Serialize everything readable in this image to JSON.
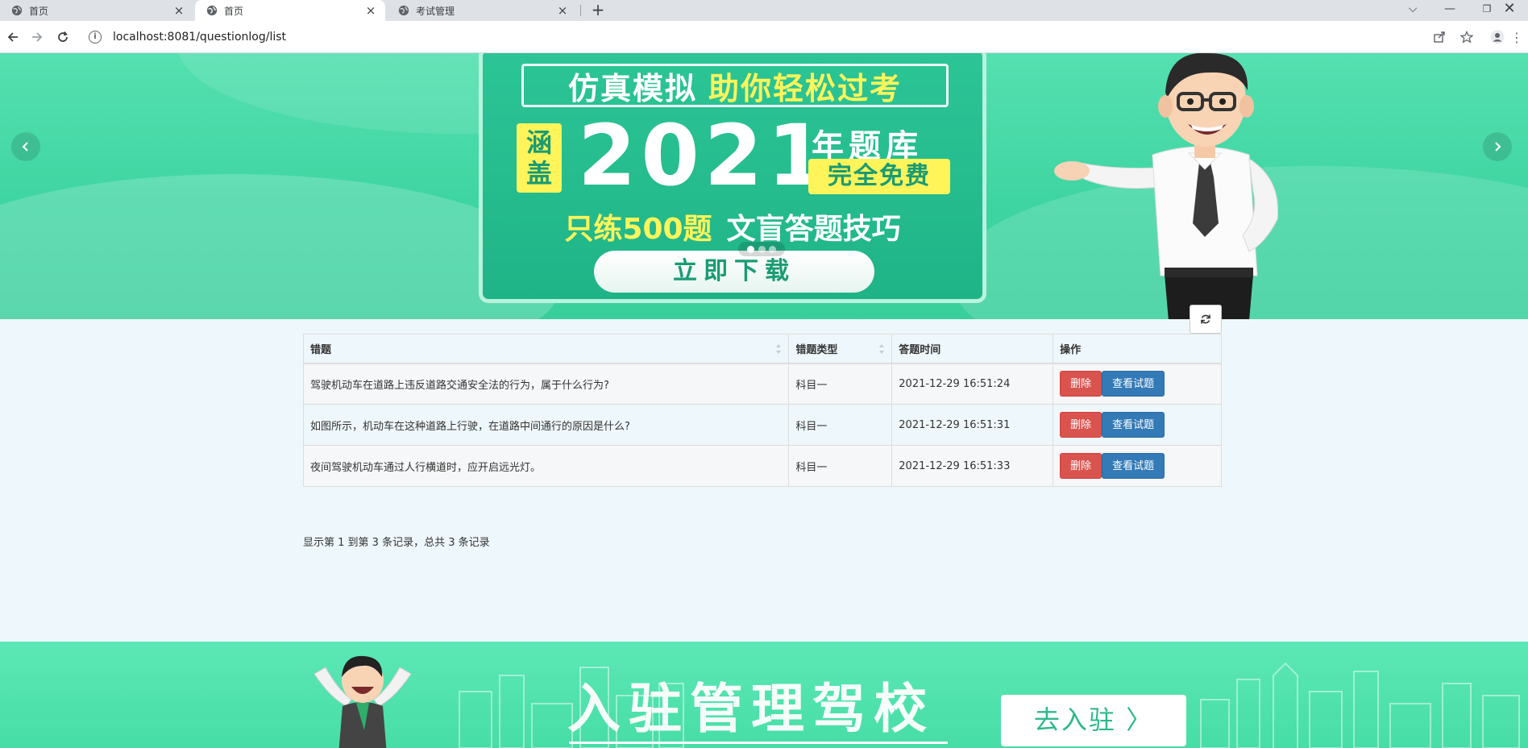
{
  "browser": {
    "tabs": [
      {
        "title": "首页",
        "active": false
      },
      {
        "title": "首页",
        "active": true
      },
      {
        "title": "考试管理",
        "active": false
      }
    ],
    "url": "localhost:8081/questionlog/list"
  },
  "banner": {
    "headline_a": "仿真模拟",
    "headline_b": "助你轻松过考",
    "cover_1": "涵",
    "cover_2": "盖",
    "year": "2021",
    "bank": "年题库",
    "free": "完全免费",
    "sub_a": "只练500题",
    "sub_b": "文盲答题技巧",
    "download": "立即下载",
    "slide_count": 3,
    "active_slide": 1
  },
  "table": {
    "columns": [
      "错题",
      "错题类型",
      "答题时间",
      "操作"
    ],
    "rows": [
      {
        "question": "驾驶机动车在道路上违反道路交通安全法的行为，属于什么行为?",
        "type": "科目一",
        "time": "2021-12-29 16:51:24"
      },
      {
        "question": "如图所示，机动车在这种道路上行驶，在道路中间通行的原因是什么?",
        "type": "科目一",
        "time": "2021-12-29 16:51:31"
      },
      {
        "question": "夜间驾驶机动车通过人行横道时，应开启远光灯。",
        "type": "科目一",
        "time": "2021-12-29 16:51:33"
      }
    ],
    "delete_label": "删除",
    "view_label": "查看试题",
    "pager_info": "显示第 1 到第 3 条记录，总共 3 条记录"
  },
  "footer": {
    "title": "入驻管理驾校",
    "button": "去入驻 〉"
  },
  "colors": {
    "banner_green": "#3fd5a2",
    "delete_red": "#d9534f",
    "view_blue": "#337ab7",
    "accent_yellow": "#fff45a"
  }
}
